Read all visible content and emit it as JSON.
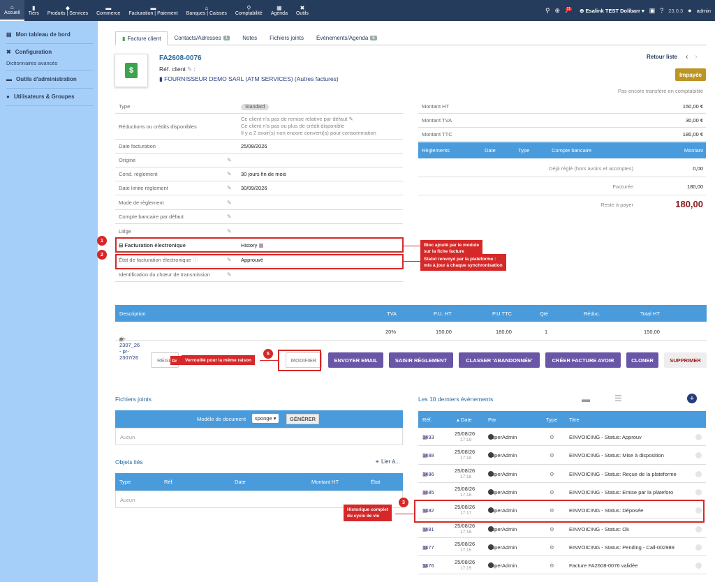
{
  "topmenu": [
    {
      "label": "Accueil",
      "icon": "home-icon",
      "glyph": "⌂",
      "active": true
    },
    {
      "label": "Tiers",
      "icon": "building-icon",
      "glyph": "▮"
    },
    {
      "label": "Produits | Services",
      "icon": "cube-icon",
      "glyph": "◆"
    },
    {
      "label": "Commerce",
      "icon": "briefcase-icon",
      "glyph": "▬"
    },
    {
      "label": "Facturation | Paiement",
      "icon": "invoice-icon",
      "glyph": "▬"
    },
    {
      "label": "Banques | Caisses",
      "icon": "bank-icon",
      "glyph": "⌂"
    },
    {
      "label": "Comptabilité",
      "icon": "search-icon",
      "glyph": "⚲"
    },
    {
      "label": "Agenda",
      "icon": "calendar-icon",
      "glyph": "▦"
    },
    {
      "label": "Outils",
      "icon": "tools-icon",
      "glyph": "✖"
    }
  ],
  "topright": {
    "notif_count": "21",
    "company": "Esalink TEST Dolibarr",
    "version": "23.0.3",
    "user": "admin"
  },
  "sidebar": {
    "items": [
      {
        "label": "Mon tableau de bord",
        "icon": "dashboard-icon"
      },
      {
        "label": "Configuration",
        "icon": "tools-icon"
      },
      {
        "label": "Outils d'administration",
        "icon": "server-icon"
      },
      {
        "label": "Utilisateurs & Groupes",
        "icon": "user-icon"
      }
    ],
    "sub": "Dictionnaires avancés"
  },
  "tabs": [
    {
      "label": "Facture client",
      "count": ""
    },
    {
      "label": "Contacts/Adresses",
      "count": "1"
    },
    {
      "label": "Notes",
      "count": ""
    },
    {
      "label": "Fichiers joints",
      "count": ""
    },
    {
      "label": "Événements/Agenda",
      "count": "6"
    }
  ],
  "invoice": {
    "ref": "FA2608-0076",
    "ref_client_label": "Réf. client",
    "thirdparty": "FOURNISSEUR DEMO SARL (ATM SERVICES) (Autres factures)",
    "retour": "Retour liste",
    "status": "Impayée",
    "compta_note": "Pas encore transféré en comptabilité"
  },
  "fields": {
    "type": {
      "label": "Type",
      "value": "Standard"
    },
    "reductions": {
      "label": "Réductions ou crédits disponibles",
      "line1": "Ce client n'a pas de remise relative par défaut",
      "line2": "Ce client n'a pas ou plus de crédit disponible",
      "line3": "Il y a 2 avoir(s) non encore converti(s) pour consommation"
    },
    "date": {
      "label": "Date facturation",
      "value": "25/08/2026"
    },
    "origine": {
      "label": "Origine",
      "value": ""
    },
    "cond": {
      "label": "Cond. règlement",
      "value": "30 jours fin de mois"
    },
    "datelim": {
      "label": "Date limite règlement",
      "value": "30/09/2026"
    },
    "mode": {
      "label": "Mode de règlement",
      "value": ""
    },
    "compte": {
      "label": "Compte bancaire par défaut",
      "value": ""
    },
    "litige": {
      "label": "Litige",
      "value": ""
    },
    "facel": {
      "label": "Facturation électronique",
      "value": "History"
    },
    "etat": {
      "label": "État de facturation électronique",
      "value": "Approuvé"
    },
    "choeur": {
      "label": "Identification du chœur de transmission",
      "value": ""
    }
  },
  "amounts": {
    "ht": {
      "label": "Montant HT",
      "value": "150,00 €"
    },
    "tva": {
      "label": "Montant TVA",
      "value": "30,00 €"
    },
    "ttc": {
      "label": "Montant TTC",
      "value": "180,00 €"
    }
  },
  "payments": {
    "headers": [
      "Règlements",
      "Date",
      "Type",
      "Compte bancaire",
      "Montant"
    ],
    "deja_label": "Déjà réglé (hors avoirs et acomptes)",
    "deja": "0,00",
    "facturee_label": "Facturée",
    "facturee": "180,00",
    "reste_label": "Reste à payer",
    "reste": "180,00"
  },
  "callouts": {
    "c1": "Bloc ajouté par le module\nsur la fiche facture",
    "c2": "Statut renvoyé par la plateforme :\nmis à jour à chaque synchronisation",
    "c3": "Historique complet\ndu cycle de vie",
    "c5": "Verrouillé pour la même raison",
    "n1": "1",
    "n2": "2",
    "n3": "3",
    "n5": "5"
  },
  "lines": {
    "headers": [
      "Description",
      "TVA",
      "P.U. HT",
      "P.U TTC",
      "Qté",
      "Réduc.",
      "Total HT"
    ],
    "rows": [
      {
        "desc": "pr-2307_26 - pr-2307/26",
        "tva": "20%",
        "puht": "150,00",
        "puttc": "180,00",
        "qty": "1",
        "reduc": "",
        "total": "150,00"
      }
    ]
  },
  "buttons": {
    "regl": "RÉGLE",
    "gr": "Gr",
    "modifier": "MODIFIER",
    "email": "ENVOYER EMAIL",
    "saisir": "SAISIR RÈGLEMENT",
    "classer": "CLASSER 'ABANDONNÉE'",
    "avoir": "CRÉER FACTURE AVOIR",
    "cloner": "CLONER",
    "supprimer": "SUPPRIMER"
  },
  "files": {
    "title": "Fichiers joints",
    "model_label": "Modèle de document",
    "model": "sponge",
    "gen": "GÉNÉRER",
    "empty": "Aucun"
  },
  "linked": {
    "title": "Objets liés",
    "link": "Lier à...",
    "headers": [
      "Type",
      "Réf.",
      "Date",
      "Montant HT",
      "État"
    ],
    "empty": "Aucun"
  },
  "events": {
    "title": "Les 10 derniers événements",
    "headers": [
      "Réf.",
      "Date",
      "Par",
      "Type",
      "Titre"
    ],
    "rows": [
      {
        "ref": "1493",
        "date": "25/08/26",
        "time": "17:19",
        "by": "SuperAdmin",
        "title": "EINVOICING - Status: Approuv"
      },
      {
        "ref": "1488",
        "date": "25/08/26",
        "time": "17:18",
        "by": "SuperAdmin",
        "title": "EINVOICING - Status: Mise à disposition"
      },
      {
        "ref": "1486",
        "date": "25/08/26",
        "time": "17:18",
        "by": "SuperAdmin",
        "title": "EINVOICING - Status: Reçue de la plateforme"
      },
      {
        "ref": "1485",
        "date": "25/08/26",
        "time": "17:18",
        "by": "SuperAdmin",
        "title": "EINVOICING - Status: Emise par la plateforo"
      },
      {
        "ref": "1482",
        "date": "25/08/26",
        "time": "17:17",
        "by": "SuperAdmin",
        "title": "EINVOICING - Status: Déposée"
      },
      {
        "ref": "1481",
        "date": "25/08/26",
        "time": "17:16",
        "by": "SuperAdmin",
        "title": "EINVOICING - Status: Ok"
      },
      {
        "ref": "1477",
        "date": "25/08/26",
        "time": "17:15",
        "by": "SuperAdmin",
        "title": "EINVOICING - Status: Pending - Call-002988"
      },
      {
        "ref": "1476",
        "date": "25/08/26",
        "time": "17:15",
        "by": "SuperAdmin",
        "title": "Facture FA2608-0076 validée"
      }
    ]
  }
}
